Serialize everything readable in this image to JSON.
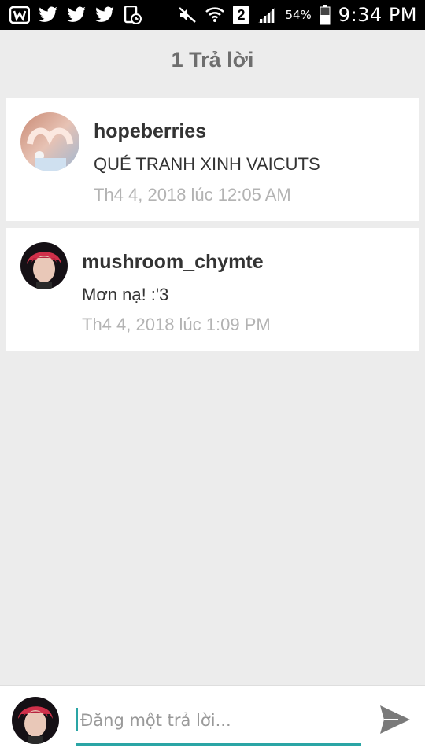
{
  "status_bar": {
    "left_icons": [
      "wattpad-icon",
      "twitter-icon",
      "twitter-icon",
      "twitter-icon",
      "clock-app-icon"
    ],
    "sim_label": "2",
    "battery": "54%",
    "time": "9:34 PM"
  },
  "header": {
    "title": "1 Trả lời"
  },
  "comments": [
    {
      "username": "hopeberries",
      "message": "QUÉ TRANH XINH VAICUTS",
      "date": "Th4 4, 2018 lúc 12:05 AM"
    },
    {
      "username": "mushroom_chymte",
      "message": "Mơn nạ! :'3",
      "date": "Th4 4, 2018 lúc 1:09 PM"
    }
  ],
  "composer": {
    "placeholder": "Đăng một trả lời...",
    "send_icon": "send-icon"
  },
  "colors": {
    "accent": "#2aa5a5",
    "background": "#ececec",
    "card": "#ffffff",
    "status_bar": "#000000"
  }
}
